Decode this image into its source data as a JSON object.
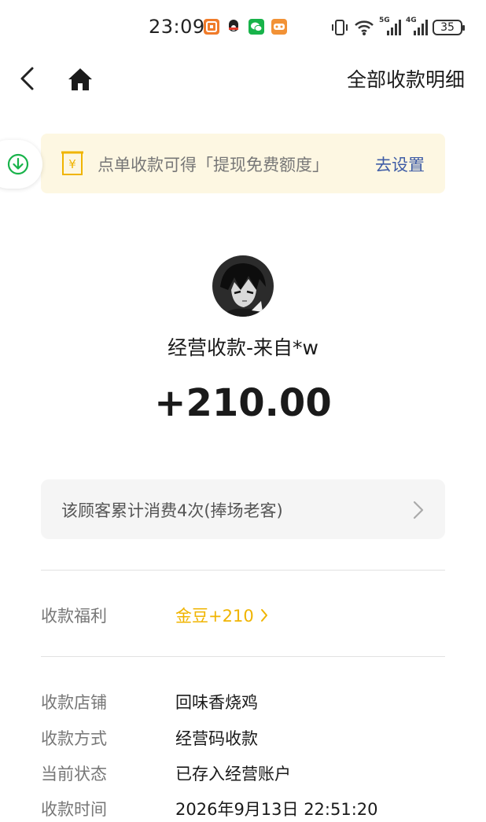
{
  "status_bar": {
    "time": "23:09",
    "network_labels": [
      "5G",
      "4G"
    ],
    "battery": "35"
  },
  "header": {
    "title": "全部收款明细"
  },
  "banner": {
    "text": "点单收款可得「提现免费额度」",
    "link": "去设置"
  },
  "payment": {
    "payer": "经营收款-来自*w",
    "amount": "+210.00"
  },
  "customer": {
    "text": "该顾客累计消费4次(捧场老客)"
  },
  "benefit": {
    "label": "收款福利",
    "value": "金豆+210"
  },
  "details": [
    {
      "label": "收款店铺",
      "value": "回味香烧鸡"
    },
    {
      "label": "收款方式",
      "value": "经营码收款"
    },
    {
      "label": "当前状态",
      "value": "已存入经营账户"
    },
    {
      "label": "收款时间",
      "value": "2026年9月13日 22:51:20"
    }
  ],
  "colors": {
    "accent_gold": "#f0b400",
    "link_blue": "#3f5da6",
    "banner_bg": "#fdf7e2",
    "green": "#18b34a"
  }
}
